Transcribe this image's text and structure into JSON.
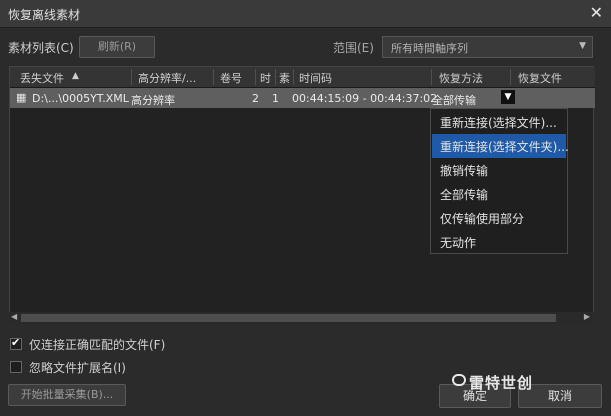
{
  "window": {
    "title": "恢复离线素材",
    "close_glyph": "✕"
  },
  "toolbar": {
    "material_list_label": "素材列表(C)",
    "refresh_label": "刷新(R)",
    "range_label": "范围(E)",
    "range_value": "所有時間軸序列"
  },
  "table": {
    "columns": [
      "丢失文件",
      "高分辨率/...",
      "卷号",
      "时",
      "素",
      "时间码",
      "恢复方法",
      "恢复文件"
    ],
    "sort_indicator": "▲",
    "rows": [
      {
        "file": "D:\\...\\0005YT.XML",
        "hires": "高分辨率",
        "reel": "2",
        "time": "1",
        "timecode": "00:44:15:09 - 00:44:37:02",
        "method": "全部传输"
      }
    ]
  },
  "menu": {
    "items": [
      "重新连接(选择文件)...",
      "重新连接(选择文件夹)...",
      "撤销传输",
      "全部传输",
      "仅传输使用部分",
      "无动作"
    ],
    "selected_index": 1
  },
  "options": {
    "only_correct_match_label": "仅连接正确匹配的文件(F)",
    "only_correct_match_checked": true,
    "ignore_extension_label": "忽略文件扩展名(I)",
    "ignore_extension_checked": false
  },
  "footer": {
    "batch_capture_label": "开始批量采集(B)...",
    "ok_label": "确定",
    "cancel_label": "取消"
  },
  "watermark": {
    "text": "雷特世创"
  }
}
